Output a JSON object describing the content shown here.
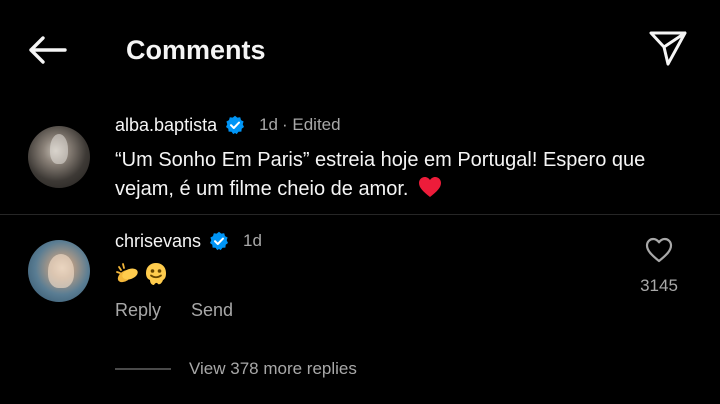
{
  "header": {
    "title": "Comments",
    "back_icon": "arrow-left-icon",
    "share_icon": "paper-plane-icon"
  },
  "caption_comment": {
    "username": "alba.baptista",
    "verified": true,
    "time": "1d",
    "edited": "· Edited",
    "text": "“Um Sonho Em Paris” estreia hoje em Portugal! Espero que vejam, é um filme cheio de amor.",
    "emoji": "red-heart"
  },
  "reply_comment": {
    "username": "chrisevans",
    "verified": true,
    "time": "1d",
    "emojis": [
      "clapping-hands",
      "melting-face"
    ],
    "reply_label": "Reply",
    "send_label": "Send",
    "like_count": "3145",
    "like_icon": "heart-outline-icon"
  },
  "view_replies": {
    "label": "View 378 more replies"
  },
  "colors": {
    "background": "#000000",
    "text": "#f5f5f5",
    "secondary_text": "#a8a8a8",
    "verified_blue": "#0095f6",
    "heart_red": "#ed1c3a"
  }
}
